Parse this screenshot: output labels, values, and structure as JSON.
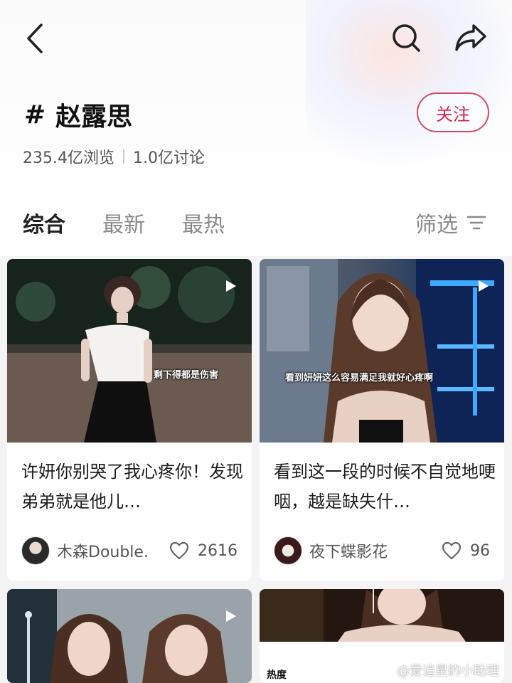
{
  "topic": {
    "hash_symbol": "#",
    "name": "赵露思",
    "follow_label": "关注",
    "views": "235.4亿浏览",
    "discussions": "1.0亿讨论"
  },
  "tabs": [
    {
      "label": "综合",
      "active": true
    },
    {
      "label": "最新",
      "active": false
    },
    {
      "label": "最热",
      "active": false
    }
  ],
  "filter_label": "筛选",
  "icons": {
    "back": "chevron-left-icon",
    "search": "search-icon",
    "share": "share-arrow-icon",
    "filter": "filter-lines-icon",
    "like": "heart-outline-icon",
    "play": "play-icon"
  },
  "colors": {
    "accent": "#d6234a",
    "background": "#f4f4f4"
  },
  "cards": [
    {
      "overlay_caption": "剩下得都是伤害",
      "title": "许妍你别哭了我心疼你！发现弟弟就是他儿…",
      "author": "木森Double.",
      "likes": "2616"
    },
    {
      "overlay_caption": "看到妍妍这么容易满足我就好心疼啊",
      "title": "看到这一段的时候不自觉地哽咽，越是缺失什…",
      "author": "夜下蝶影花",
      "likes": "96"
    }
  ],
  "card4_hot_label": "热度",
  "watermark": "@爱追星的小助理"
}
